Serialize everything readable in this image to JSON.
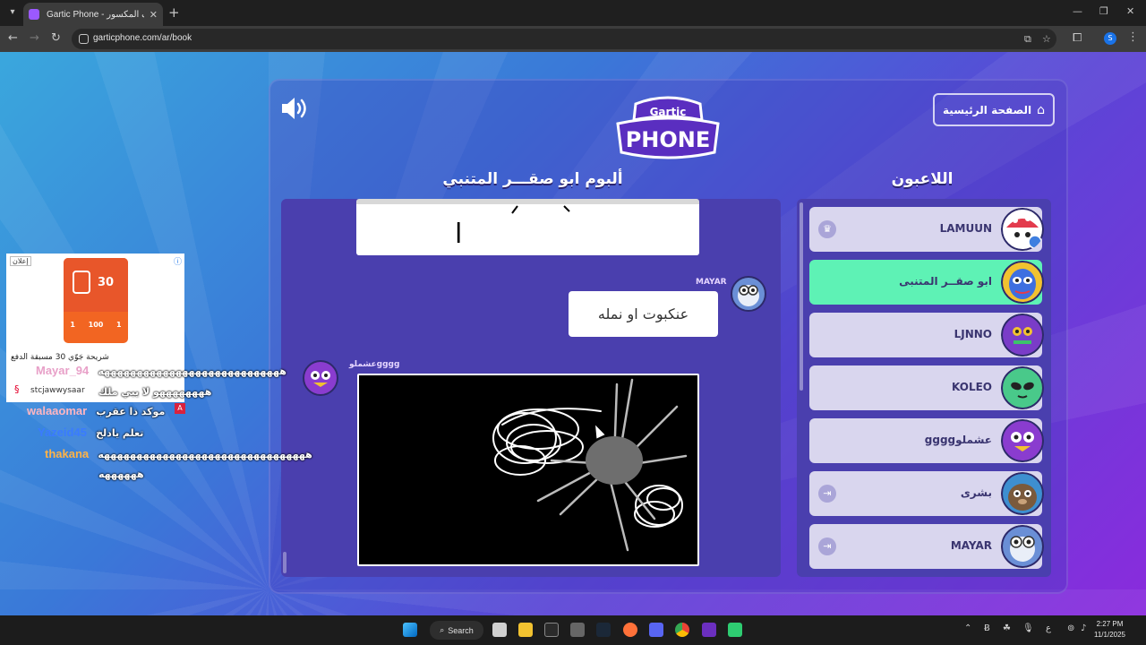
{
  "browser": {
    "tab_title": "Gartic Phone - الهاتف المكسور",
    "url": "garticphone.com/ar/book",
    "profile_initial": "S"
  },
  "game": {
    "home_button": "الصفحة الرئيسية",
    "logo_top": "Gartic",
    "logo_bottom": "PHONE",
    "album_title": "ألبوم ابو صقـــر المتنبي",
    "players_title": "اللاعبون",
    "top_drawing_letter": "ا",
    "messages": [
      {
        "author": "MAYAR",
        "text": "عنكبوت او نمله"
      },
      {
        "author": "عشملوgggg"
      }
    ],
    "players": [
      {
        "name": "LAMUUN",
        "icon": "crown-icon",
        "active": false
      },
      {
        "name": "ابو صقــر المتنبى",
        "icon": "",
        "active": true
      },
      {
        "name": "LJNNO",
        "icon": "",
        "active": false
      },
      {
        "name": "KOLEO",
        "icon": "",
        "active": false
      },
      {
        "name": "عشملوgggg",
        "icon": "",
        "active": false
      },
      {
        "name": "بشرى",
        "icon": "exit-icon",
        "active": false
      },
      {
        "name": "MAYAR",
        "icon": "exit-icon",
        "active": false
      }
    ]
  },
  "ad": {
    "badge": "إعلان",
    "sim_number": "30",
    "sim_plans": [
      "1",
      "100",
      "1"
    ],
    "text": "شريحة جَوّي 30 مسبقة الدفع",
    "brand": "stcjawwysaar"
  },
  "chat": [
    {
      "user": "Mayar_94",
      "color": "#e8a0c8",
      "msg": "ههههههههههههههههههههههههههههه"
    },
    {
      "user": "",
      "color": "#ffffff",
      "msg": "ههههههههو لا يبي ملك"
    },
    {
      "user": "walaaomar",
      "color": "#ffb6c1",
      "msg": "موكد ذا عقرب"
    },
    {
      "user": "Yazeid45",
      "color": "#3a7bff",
      "msg": "تعلم يادلخ"
    },
    {
      "user": "thakana",
      "color": "#ffb347",
      "msg": "ههههههههههههههههههههههههههههههههه"
    },
    {
      "user": "",
      "color": "#ffffff",
      "msg": "ههههههه"
    }
  ],
  "taskbar": {
    "search_label": "Search",
    "time": "2:27 PM",
    "date": "11/1/2025",
    "lang": "ع"
  }
}
